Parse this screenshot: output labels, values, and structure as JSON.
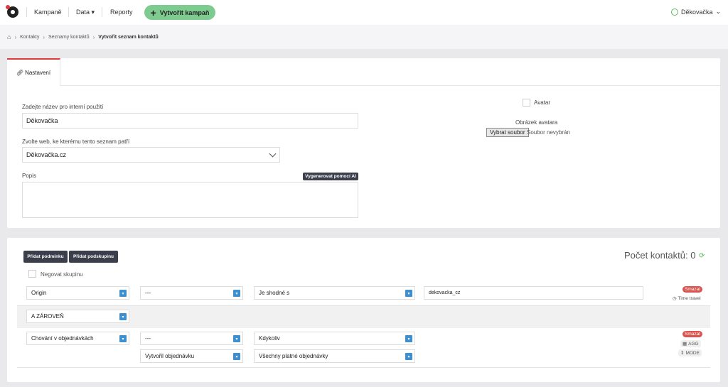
{
  "topbar": {
    "nav": [
      "Kampaně",
      "Data",
      "Reporty"
    ],
    "create_button": "Vytvořit kampaň",
    "user": "Děkovačka"
  },
  "breadcrumb": [
    "Kontakty",
    "Seznamy kontaktů",
    "Vytvořit seznam kontaktů"
  ],
  "tab": "Nastavení",
  "form": {
    "name_label": "Zadejte název pro interní použití",
    "name_value": "Děkovačka",
    "web_label": "Zvolte web, ke kterému tento seznam patří",
    "web_value": "Děkovačka.cz",
    "desc_label": "Popis",
    "ai_button": "Vygenerovat pomocí AI",
    "desc_value": "",
    "avatar_label": "Avatar",
    "avatar_image_label": "Obrázek avatara",
    "file_button": "Vybrat soubor",
    "file_status": "Soubor nevybrán"
  },
  "conditions": {
    "add_condition": "Přidat podmínku",
    "add_subgroup": "Přidat podskupinu",
    "negate": "Negovat skupinu",
    "count_label": "Počet kontaktů: 0",
    "row1": {
      "field": "Origin",
      "sub": "---",
      "operator": "Je shodné s",
      "value": "dekovacka_cz",
      "delete": "Smazat",
      "time_travel": "Time travel"
    },
    "joiner": "A ZÁROVEŇ",
    "row2": {
      "field": "Chování v objednávkách",
      "sub": "---",
      "operator": "Kdykoliv",
      "sub2": "Vytvořil objednávku",
      "operator2": "Všechny platné objednávky",
      "delete": "Smazat",
      "agg": "AGG",
      "mode": "MODE"
    }
  },
  "colors": {
    "accent_green": "#7dcb8f",
    "accent_red": "#e03b3b",
    "select_blue": "#3d8fcf",
    "dark_button": "#3a3f4b"
  }
}
